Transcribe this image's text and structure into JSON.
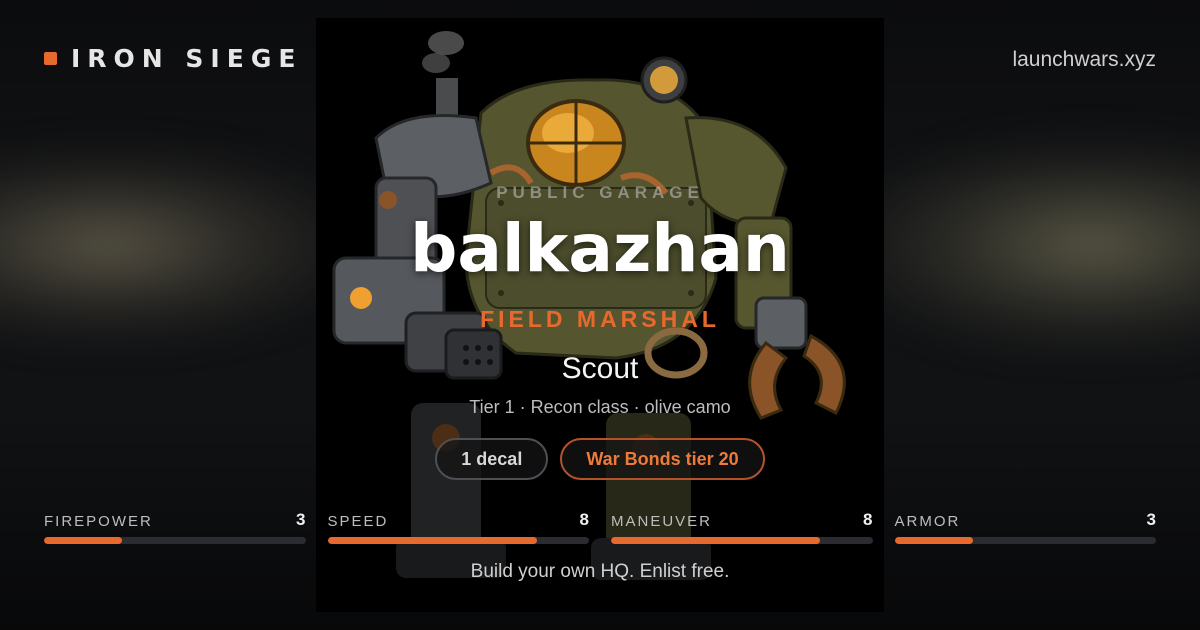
{
  "brand": {
    "name": "IRON SIEGE",
    "domain": "launchwars.xyz"
  },
  "card": {
    "kicker": "PUBLIC GARAGE",
    "name": "balkazhan",
    "rank": "FIELD MARSHAL",
    "model": "Scout",
    "meta": "Tier 1 · Recon class · olive camo",
    "badges": [
      "1 decal",
      "War Bonds tier 20"
    ]
  },
  "stats": [
    {
      "label": "FIREPOWER",
      "value": "3",
      "fraction": 0.3
    },
    {
      "label": "SPEED",
      "value": "8",
      "fraction": 0.8
    },
    {
      "label": "MANEUVER",
      "value": "8",
      "fraction": 0.8
    },
    {
      "label": "ARMOR",
      "value": "3",
      "fraction": 0.3
    }
  ],
  "footer": "Build your own HQ. Enlist free.",
  "colors": {
    "accent": "#e8692d",
    "background": "#111214",
    "mech_olive": "#5a5a34",
    "mech_steel": "#5b5e63",
    "mech_copper": "#a8642e"
  }
}
